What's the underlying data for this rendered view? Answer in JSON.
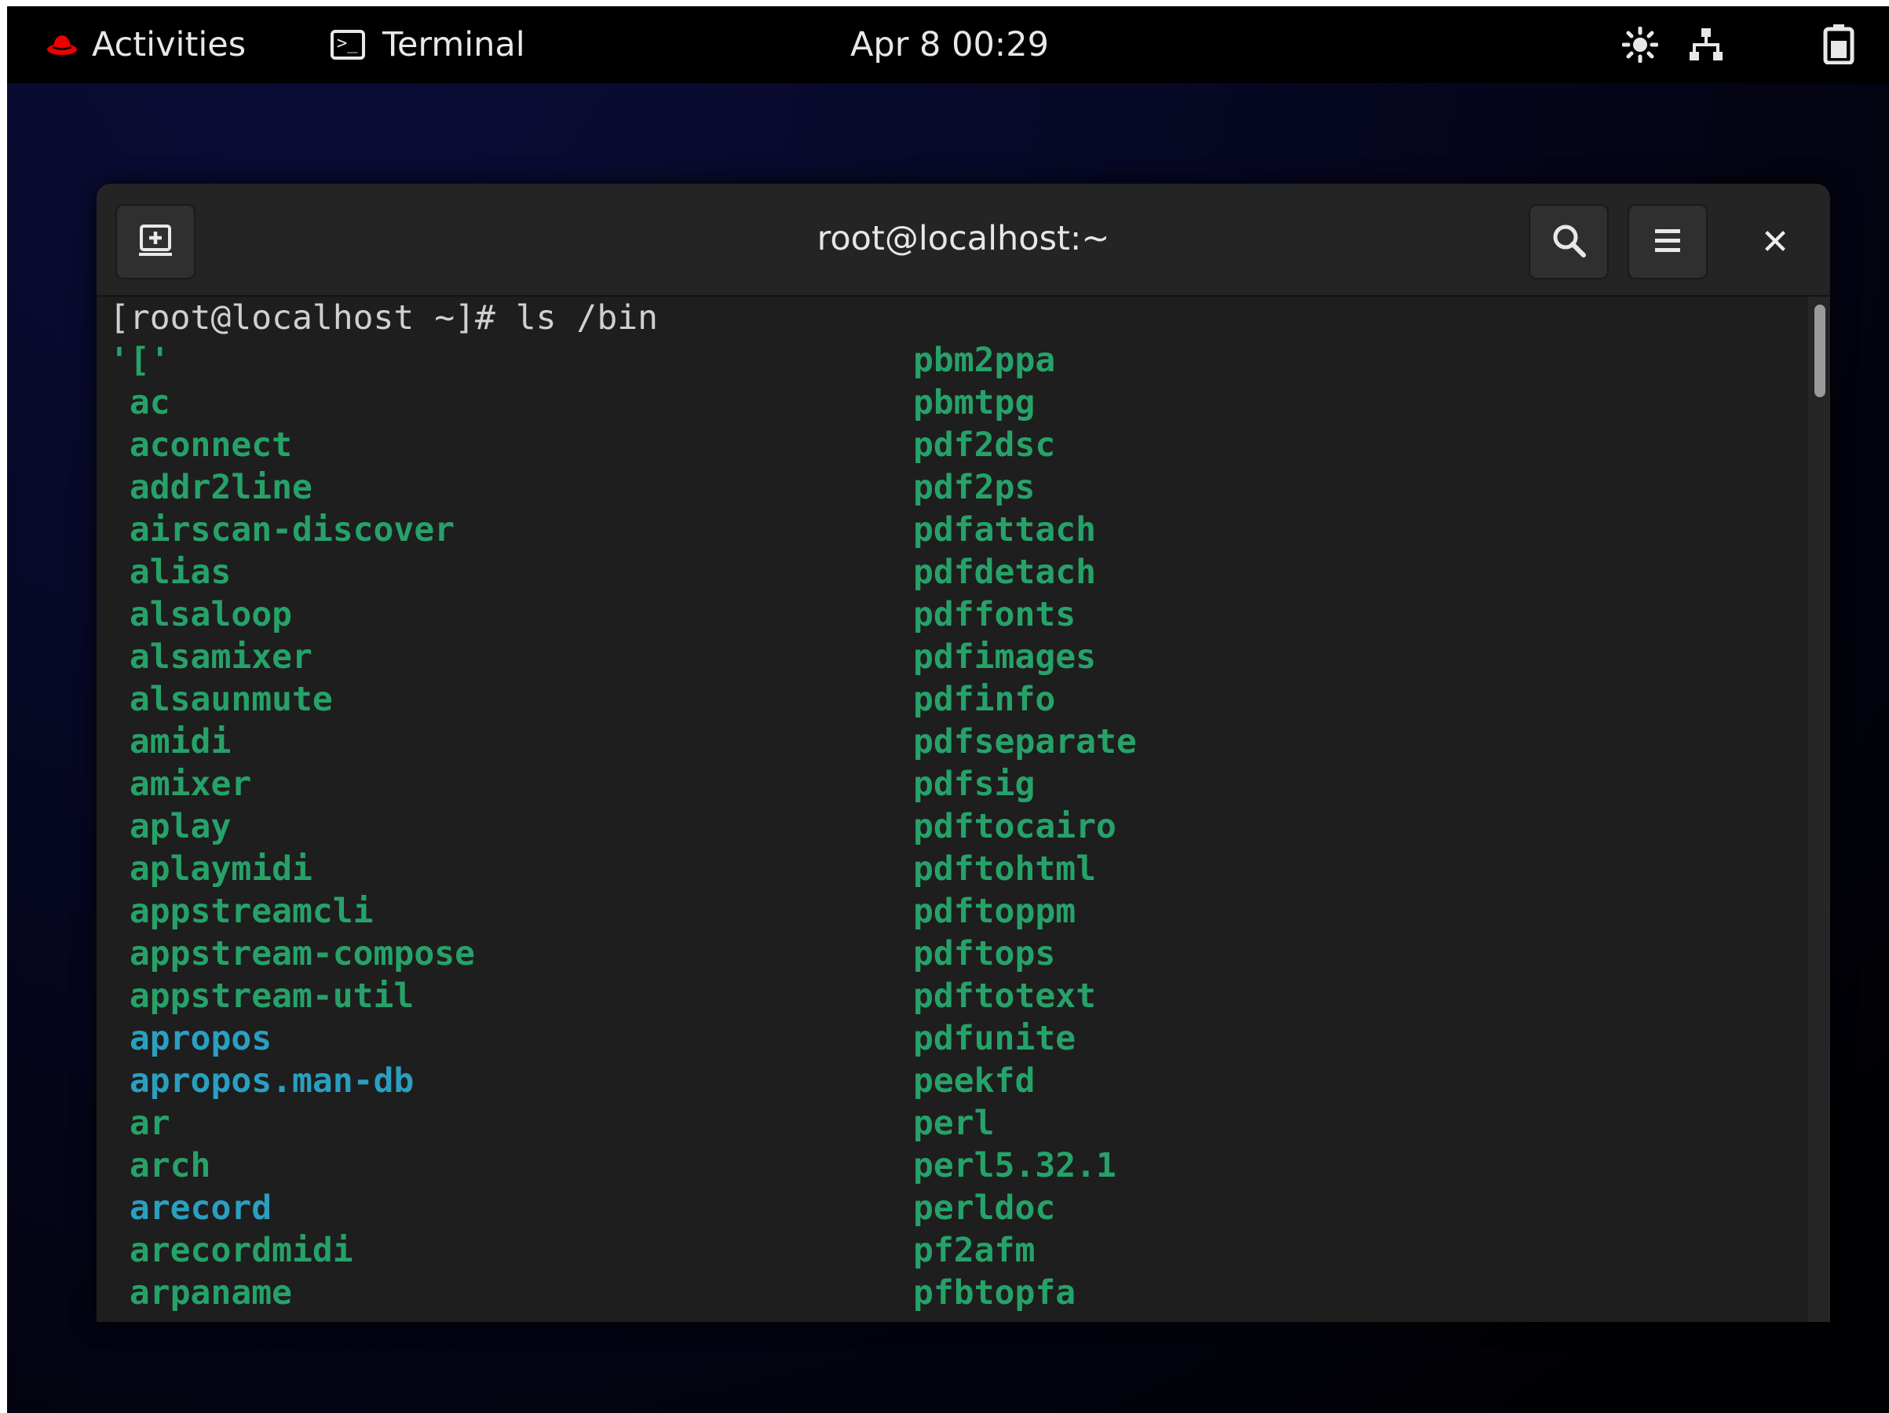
{
  "topbar": {
    "activities_label": "Activities",
    "app_label": "Terminal",
    "clock": "Apr 8  00:29",
    "icons": [
      "redhat-logo-icon",
      "terminal-icon",
      "brightness-icon",
      "network-icon",
      "battery-icon"
    ]
  },
  "window": {
    "title": "root@localhost:~",
    "buttons": {
      "new_tab_icon": "new-tab-icon",
      "search_icon": "search-icon",
      "menu_icon": "hamburger-menu-icon",
      "close_label": "✕"
    }
  },
  "terminal": {
    "prompt": "[root@localhost ~]# ls /bin",
    "left_column": [
      {
        "name": "'['",
        "type": "exec"
      },
      {
        "name": " ac",
        "type": "exec"
      },
      {
        "name": " aconnect",
        "type": "exec"
      },
      {
        "name": " addr2line",
        "type": "exec"
      },
      {
        "name": " airscan-discover",
        "type": "exec"
      },
      {
        "name": " alias",
        "type": "exec"
      },
      {
        "name": " alsaloop",
        "type": "exec"
      },
      {
        "name": " alsamixer",
        "type": "exec"
      },
      {
        "name": " alsaunmute",
        "type": "exec"
      },
      {
        "name": " amidi",
        "type": "exec"
      },
      {
        "name": " amixer",
        "type": "exec"
      },
      {
        "name": " aplay",
        "type": "exec"
      },
      {
        "name": " aplaymidi",
        "type": "exec"
      },
      {
        "name": " appstreamcli",
        "type": "exec"
      },
      {
        "name": " appstream-compose",
        "type": "exec"
      },
      {
        "name": " appstream-util",
        "type": "exec"
      },
      {
        "name": " apropos",
        "type": "link"
      },
      {
        "name": " apropos.man-db",
        "type": "link"
      },
      {
        "name": " ar",
        "type": "exec"
      },
      {
        "name": " arch",
        "type": "exec"
      },
      {
        "name": " arecord",
        "type": "link"
      },
      {
        "name": " arecordmidi",
        "type": "exec"
      },
      {
        "name": " arpaname",
        "type": "exec"
      }
    ],
    "right_column": [
      {
        "name": "pbm2ppa",
        "type": "exec"
      },
      {
        "name": "pbmtpg",
        "type": "exec"
      },
      {
        "name": "pdf2dsc",
        "type": "exec"
      },
      {
        "name": "pdf2ps",
        "type": "exec"
      },
      {
        "name": "pdfattach",
        "type": "exec"
      },
      {
        "name": "pdfdetach",
        "type": "exec"
      },
      {
        "name": "pdffonts",
        "type": "exec"
      },
      {
        "name": "pdfimages",
        "type": "exec"
      },
      {
        "name": "pdfinfo",
        "type": "exec"
      },
      {
        "name": "pdfseparate",
        "type": "exec"
      },
      {
        "name": "pdfsig",
        "type": "exec"
      },
      {
        "name": "pdftocairo",
        "type": "exec"
      },
      {
        "name": "pdftohtml",
        "type": "exec"
      },
      {
        "name": "pdftoppm",
        "type": "exec"
      },
      {
        "name": "pdftops",
        "type": "exec"
      },
      {
        "name": "pdftotext",
        "type": "exec"
      },
      {
        "name": "pdfunite",
        "type": "exec"
      },
      {
        "name": "peekfd",
        "type": "exec"
      },
      {
        "name": "perl",
        "type": "exec"
      },
      {
        "name": "perl5.32.1",
        "type": "exec"
      },
      {
        "name": "perldoc",
        "type": "exec"
      },
      {
        "name": "pf2afm",
        "type": "exec"
      },
      {
        "name": "pfbtopfa",
        "type": "exec"
      }
    ],
    "colors": {
      "exec": "#26a269",
      "link": "#2a9fc0",
      "text": "#d0d0d0",
      "background": "#1e1e1e"
    }
  }
}
